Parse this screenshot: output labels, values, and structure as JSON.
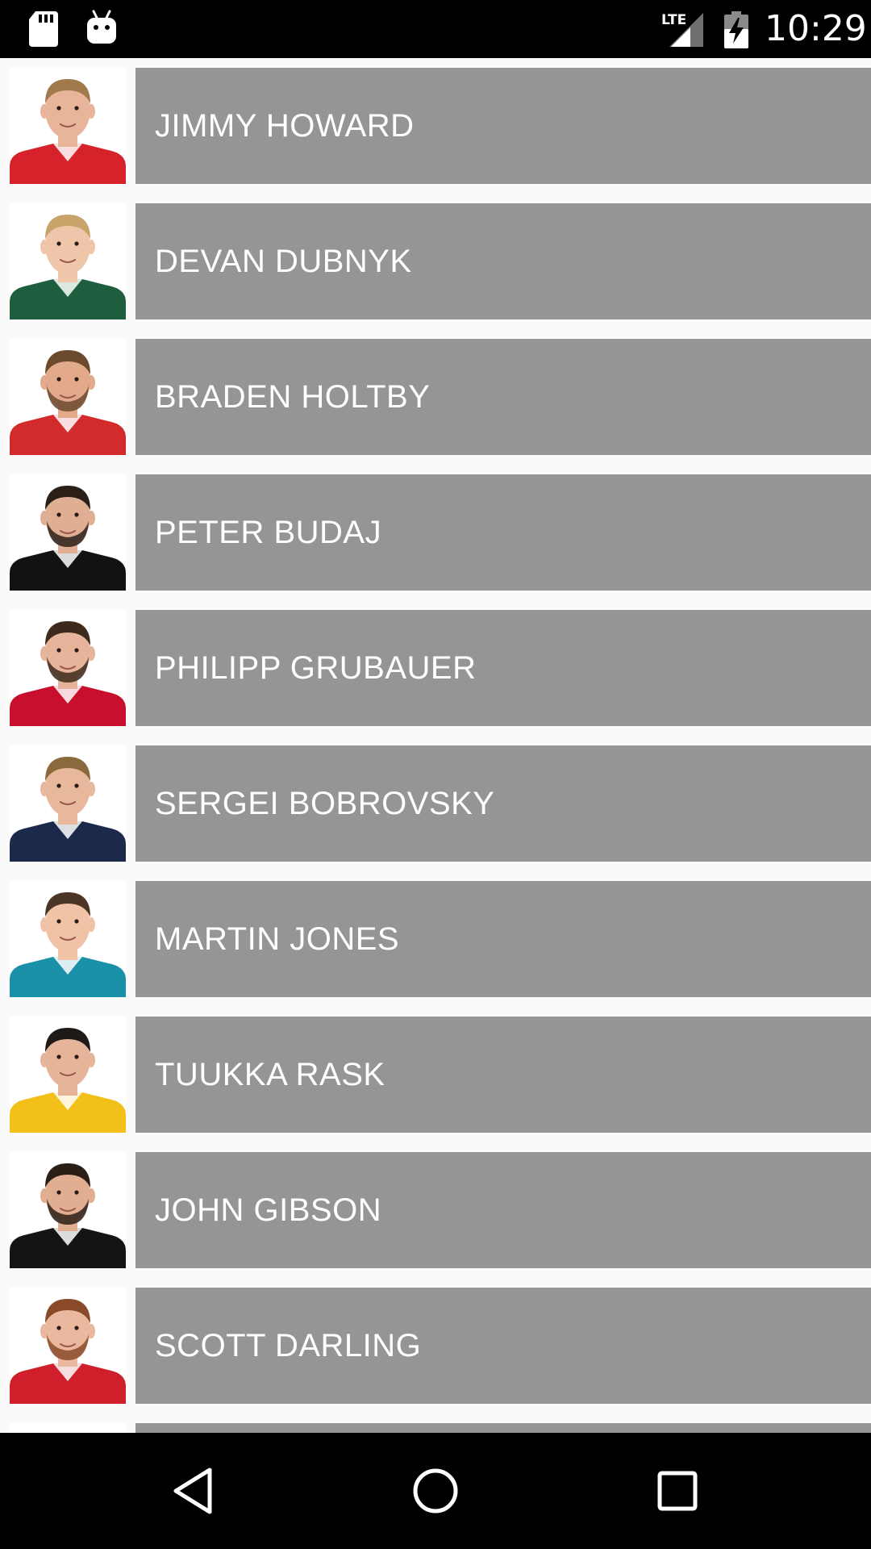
{
  "status_bar": {
    "time": "10:29",
    "network": "LTE",
    "icons": [
      "sd-card-icon",
      "android-icon",
      "signal-icon",
      "battery-charging-icon"
    ]
  },
  "players": [
    {
      "name": "JIMMY HOWARD",
      "jersey_color": "#d6232b",
      "hair": "#a07a4a",
      "skin": "#e8b49a",
      "beard": false
    },
    {
      "name": "DEVAN DUBNYK",
      "jersey_color": "#1f5d3f",
      "hair": "#c9a46a",
      "skin": "#f0c6aa",
      "beard": false
    },
    {
      "name": "BRADEN HOLTBY",
      "jersey_color": "#d32b2b",
      "hair": "#6b4a2e",
      "skin": "#e2a98a",
      "beard": true
    },
    {
      "name": "PETER BUDAJ",
      "jersey_color": "#111111",
      "hair": "#2a2018",
      "skin": "#e0ae92",
      "beard": true
    },
    {
      "name": "PHILIPP GRUBAUER",
      "jersey_color": "#c8102e",
      "hair": "#3d2a1c",
      "skin": "#e6b49a",
      "beard": true
    },
    {
      "name": "SERGEI BOBROVSKY",
      "jersey_color": "#1b2a4a",
      "hair": "#8a6a3c",
      "skin": "#e8b89c",
      "beard": false
    },
    {
      "name": "MARTIN JONES",
      "jersey_color": "#1a8fa8",
      "hair": "#4a3526",
      "skin": "#f0c2a6",
      "beard": false
    },
    {
      "name": "TUUKKA RASK",
      "jersey_color": "#f2c018",
      "hair": "#1e1a18",
      "skin": "#e6b498",
      "beard": false
    },
    {
      "name": "JOHN GIBSON",
      "jersey_color": "#141414",
      "hair": "#2a1e16",
      "skin": "#e2ae92",
      "beard": true
    },
    {
      "name": "SCOTT DARLING",
      "jersey_color": "#cf1f2a",
      "hair": "#8a4a2a",
      "skin": "#eab89e",
      "beard": true
    },
    {
      "name": "",
      "jersey_color": "#1a1a1a",
      "hair": "#2a1e16",
      "skin": "#e2ae92",
      "beard": false
    }
  ],
  "nav_bar": {
    "buttons": [
      "back-icon",
      "home-icon",
      "recents-icon"
    ]
  }
}
